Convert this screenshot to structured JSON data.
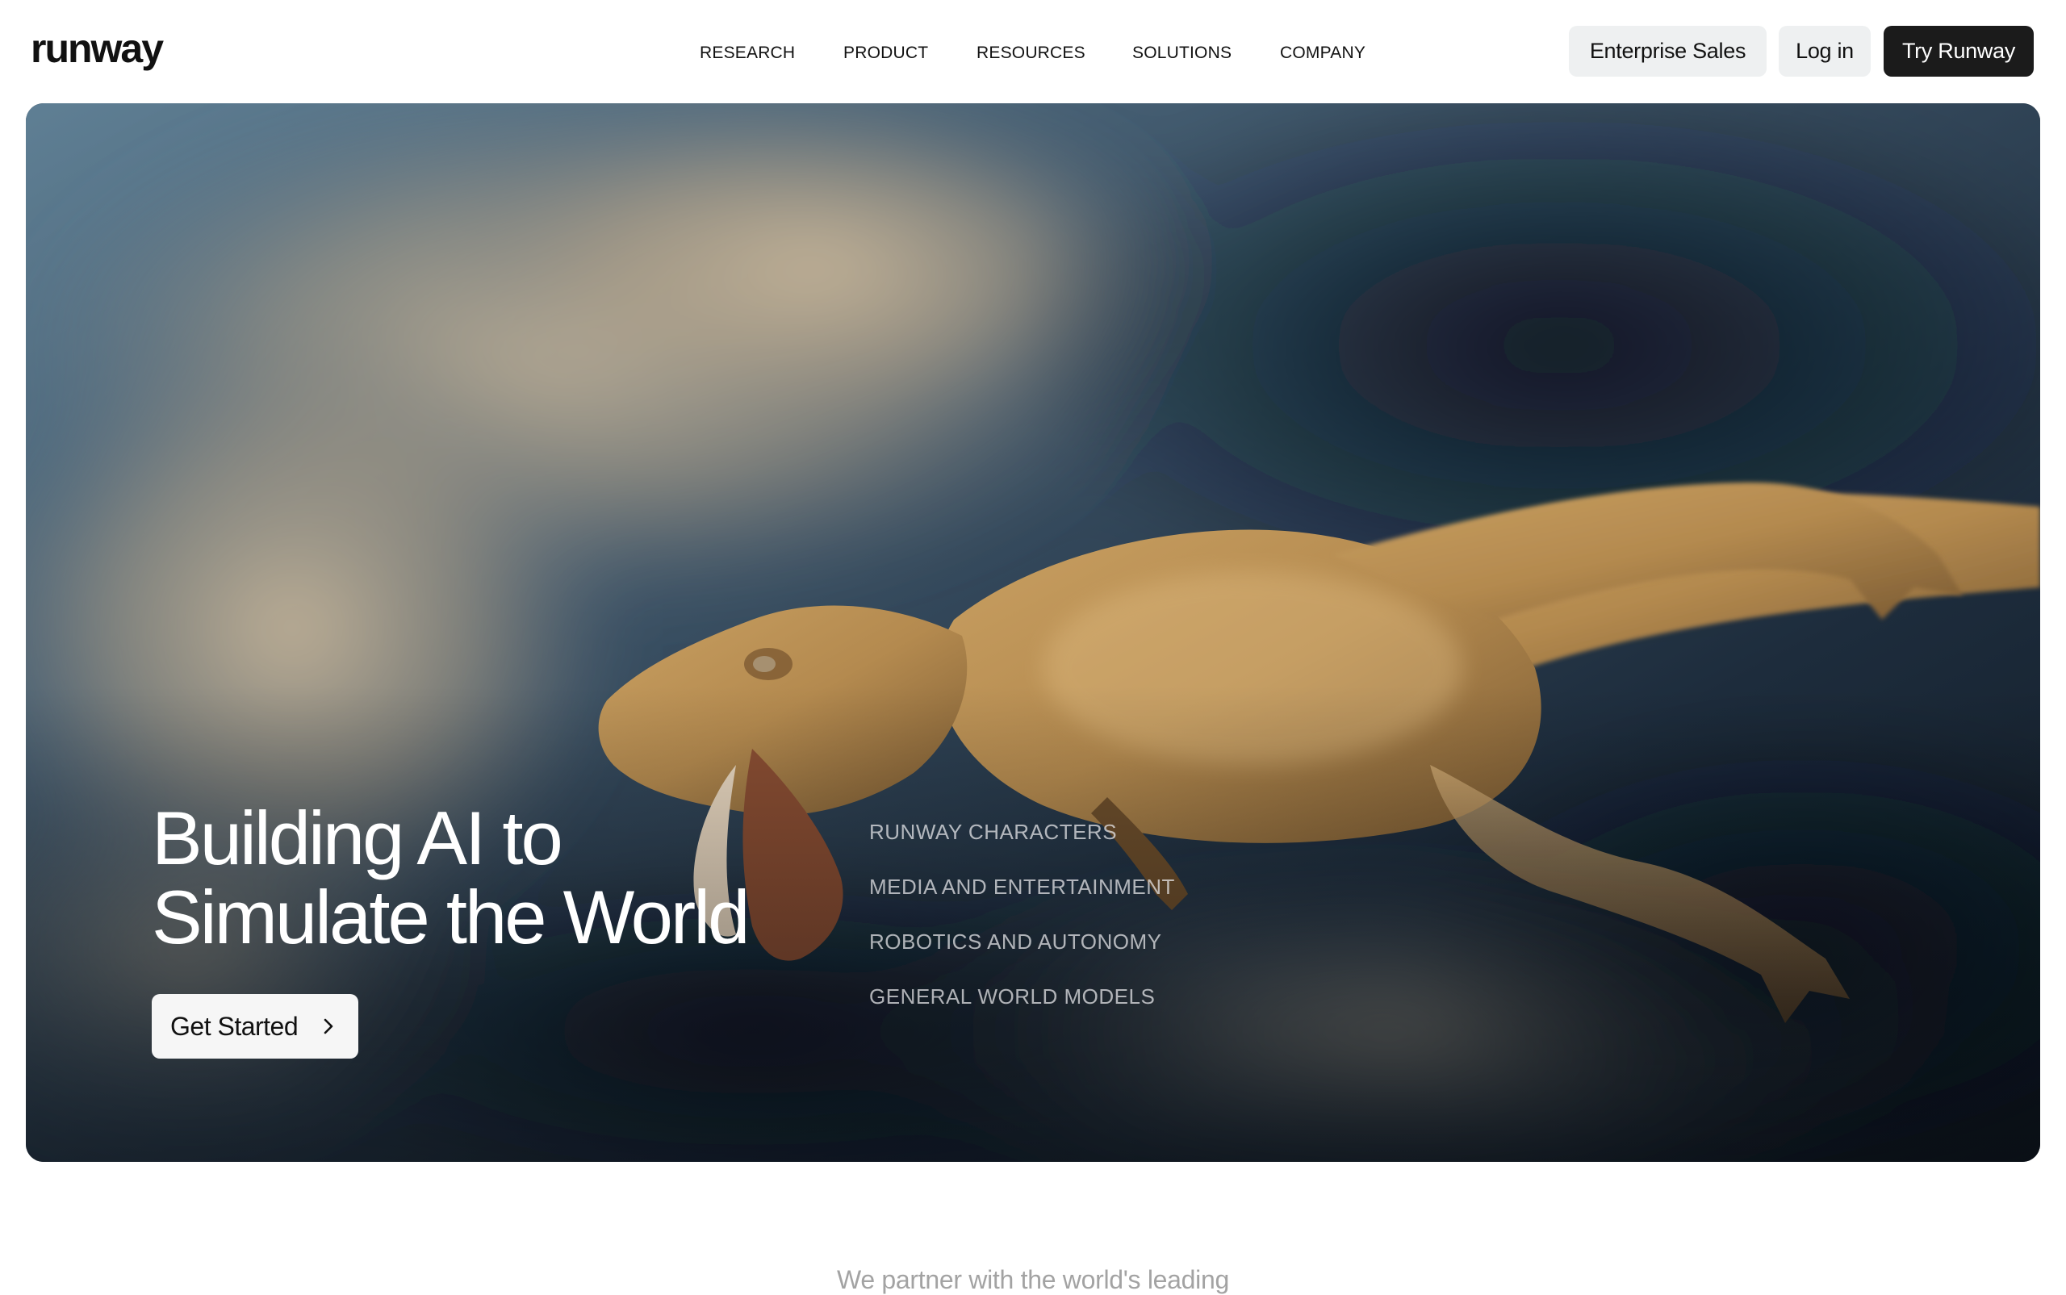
{
  "header": {
    "logo_text": "runway",
    "nav": [
      {
        "label": "RESEARCH"
      },
      {
        "label": "PRODUCT"
      },
      {
        "label": "RESOURCES"
      },
      {
        "label": "SOLUTIONS"
      },
      {
        "label": "COMPANY"
      }
    ],
    "buttons": {
      "enterprise_sales": "Enterprise Sales",
      "log_in": "Log in",
      "try_runway": "Try Runway"
    }
  },
  "hero": {
    "title_line1": "Building AI to",
    "title_line2": "Simulate the World",
    "cta_label": "Get Started",
    "cta_icon": "chevron-right-icon",
    "categories": [
      {
        "label": "RUNWAY CHARACTERS"
      },
      {
        "label": "MEDIA AND ENTERTAINMENT"
      },
      {
        "label": "ROBOTICS AND AUTONOMY"
      },
      {
        "label": "GENERAL WORLD MODELS"
      }
    ]
  },
  "partner": {
    "text": "We partner with the world's leading"
  },
  "colors": {
    "primary_dark": "#1b1b1b",
    "button_light": "#eef0f1",
    "hero_overlay_text": "#ffffff",
    "category_text": "#ebebee",
    "muted_text": "#a3a3a3"
  }
}
